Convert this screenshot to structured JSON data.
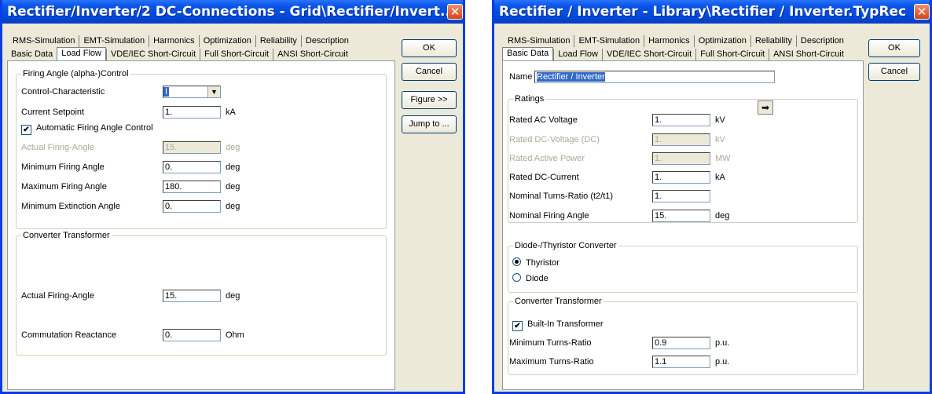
{
  "win1": {
    "title": "Rectifier/Inverter/2 DC-Connections - Grid\\Rectifier/Invert...",
    "close": "✕",
    "tabs_row1": [
      "RMS-Simulation",
      "EMT-Simulation",
      "Harmonics",
      "Optimization",
      "Reliability",
      "Description"
    ],
    "tabs_row2": [
      "Basic Data",
      "Load Flow",
      "VDE/IEC Short-Circuit",
      "Full Short-Circuit",
      "ANSI Short-Circuit"
    ],
    "buttons": {
      "ok": "OK",
      "cancel": "Cancel",
      "figure": "Figure >>",
      "jump": "Jump to ..."
    },
    "firing": {
      "title": "Firing Angle (alpha-)Control",
      "control_char_label": "Control-Characteristic",
      "control_char_value": "I",
      "current_setpoint_label": "Current Setpoint",
      "current_setpoint_value": "1.",
      "current_setpoint_unit": "kA",
      "auto_label": "Automatic Firing Angle Control",
      "auto_checked": "✔",
      "actual_label": "Actual Firing-Angle",
      "actual_value": "15.",
      "actual_unit": "deg",
      "min_label": "Minimum Firing Angle",
      "min_value": "0.",
      "min_unit": "deg",
      "max_label": "Maximum Firing Angle",
      "max_value": "180.",
      "max_unit": "deg",
      "ext_label": "Minimum Extinction Angle",
      "ext_value": "0.",
      "ext_unit": "deg"
    },
    "transformer": {
      "title": "Converter Transformer",
      "actual_label": "Actual Firing-Angle",
      "actual_value": "15.",
      "actual_unit": "deg",
      "comm_label": "Commutation Reactance",
      "comm_value": "0.",
      "comm_unit": "Ohm"
    }
  },
  "win2": {
    "title": "Rectifier / Inverter - Library\\Rectifier / Inverter.TypRec",
    "close": "✕",
    "tabs_row1": [
      "RMS-Simulation",
      "EMT-Simulation",
      "Harmonics",
      "Optimization",
      "Reliability",
      "Description"
    ],
    "tabs_row2": [
      "Basic Data",
      "Load Flow",
      "VDE/IEC Short-Circuit",
      "Full Short-Circuit",
      "ANSI Short-Circuit"
    ],
    "buttons": {
      "ok": "OK",
      "cancel": "Cancel"
    },
    "name_label": "Name",
    "name_value": "Rectifier / Inverter",
    "ratings": {
      "title": "Ratings",
      "arrow": "➡",
      "ac_label": "Rated AC Voltage",
      "ac_value": "1.",
      "ac_unit": "kV",
      "dcv_label": "Rated DC-Voltage (DC)",
      "dcv_value": "1.",
      "dcv_unit": "kV",
      "ap_label": "Rated Active Power",
      "ap_value": "1.",
      "ap_unit": "MW",
      "dcc_label": "Rated DC-Current",
      "dcc_value": "1.",
      "dcc_unit": "kA",
      "ntr_label": "Nominal Turns-Ratio (t2/t1)",
      "ntr_value": "1.",
      "nfa_label": "Nominal Firing Angle",
      "nfa_value": "15.",
      "nfa_unit": "deg"
    },
    "converter": {
      "title": "Diode-/Thyristor Converter",
      "thyristor": "Thyristor",
      "diode": "Diode",
      "selected": "Thyristor"
    },
    "transformer": {
      "title": "Converter Transformer",
      "builtin_label": "Built-In Transformer",
      "builtin_checked": "✔",
      "min_label": "Minimum Turns-Ratio",
      "min_value": "0.9",
      "min_unit": "p.u.",
      "max_label": "Maximum Turns-Ratio",
      "max_value": "1.1",
      "max_unit": "p.u."
    }
  }
}
